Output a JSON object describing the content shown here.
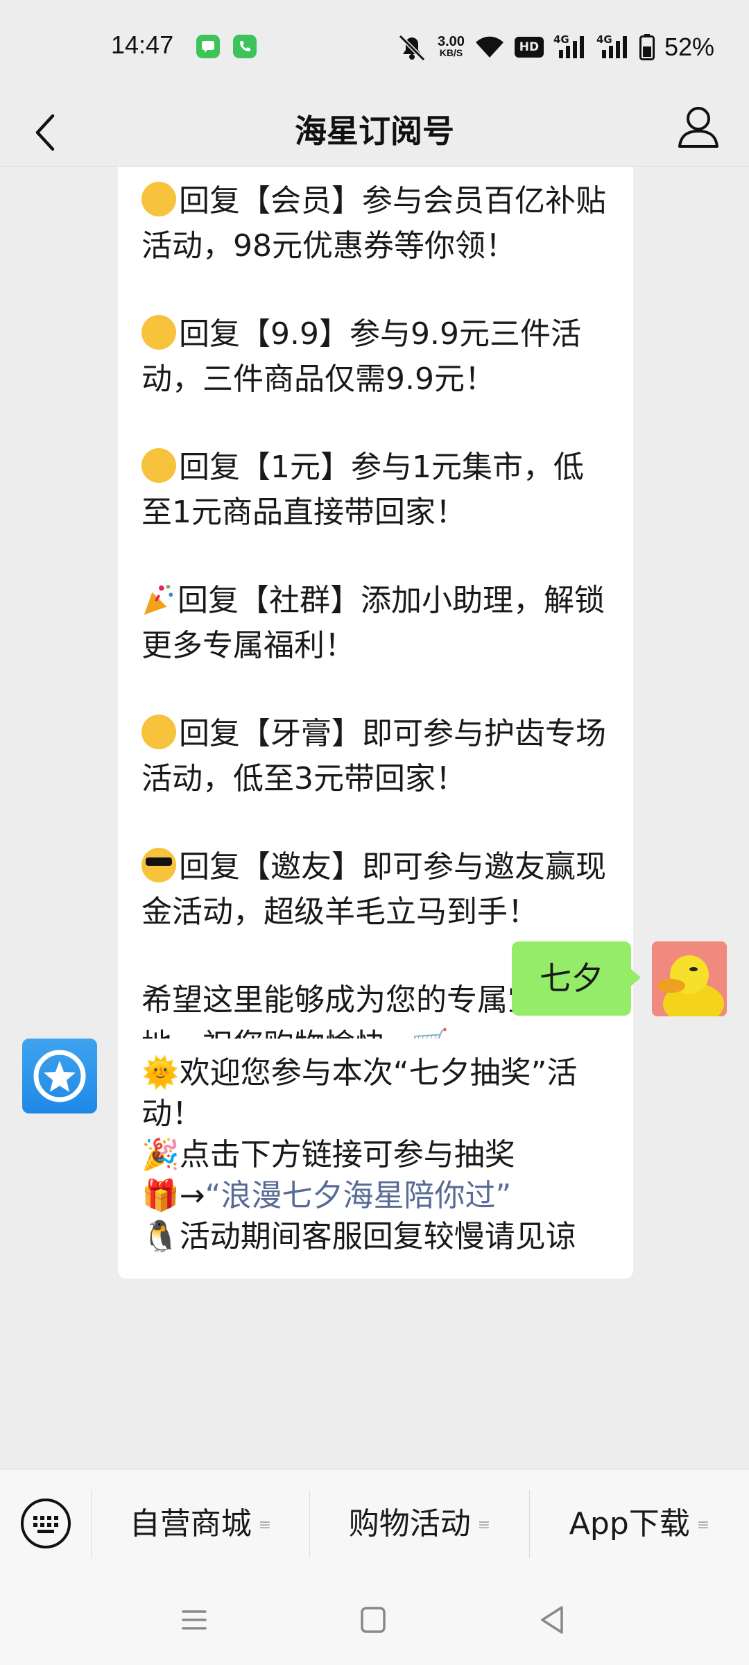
{
  "status_bar": {
    "time": "14:47",
    "net_speed_value": "3.00",
    "net_speed_unit": "KB/S",
    "hd_label": "HD",
    "signal1_label": "4G",
    "signal2_label": "4G",
    "battery_percent": "52%"
  },
  "nav": {
    "title": "海星订阅号"
  },
  "messages": {
    "bot_first": {
      "lines": [
        {
          "emoji": "😲",
          "text": "回复【会员】参与会员百亿补贴活动，98元优惠券等你领！"
        },
        {
          "emoji": "🤨",
          "text": "回复【9.9】参与9.9元三件活动，三件商品仅需9.9元！"
        },
        {
          "emoji": "🤭",
          "text": "回复【1元】参与1元集市，低至1元商品直接带回家！"
        },
        {
          "emoji": "🎉",
          "text": "回复【社群】添加小助理，解锁更多专属福利！"
        },
        {
          "emoji": "😁",
          "text": "回复【牙膏】即可参与护齿专场活动，低至3元带回家！"
        },
        {
          "emoji": "😎",
          "text": "回复【邀友】即可参与邀友赢现金活动，超级羊毛立马到手！"
        }
      ],
      "closing": "希望这里能够成为您的专属宝藏地，祝您购物愉快~🛒"
    },
    "user_reply": "七夕",
    "bot_second": {
      "line1": "🌞欢迎您参与本次“七夕抽奖”活动！",
      "line2": "🎉点击下方链接可参与抽奖",
      "line3_prefix": "🎁→",
      "line3_link": "“浪漫七夕海星陪你过”",
      "line4": "🐧活动期间客服回复较慢请见谅"
    }
  },
  "menu": {
    "items": [
      {
        "label": "自营商城"
      },
      {
        "label": "购物活动"
      },
      {
        "label": "App下载"
      }
    ],
    "lines_glyph": "≡"
  }
}
